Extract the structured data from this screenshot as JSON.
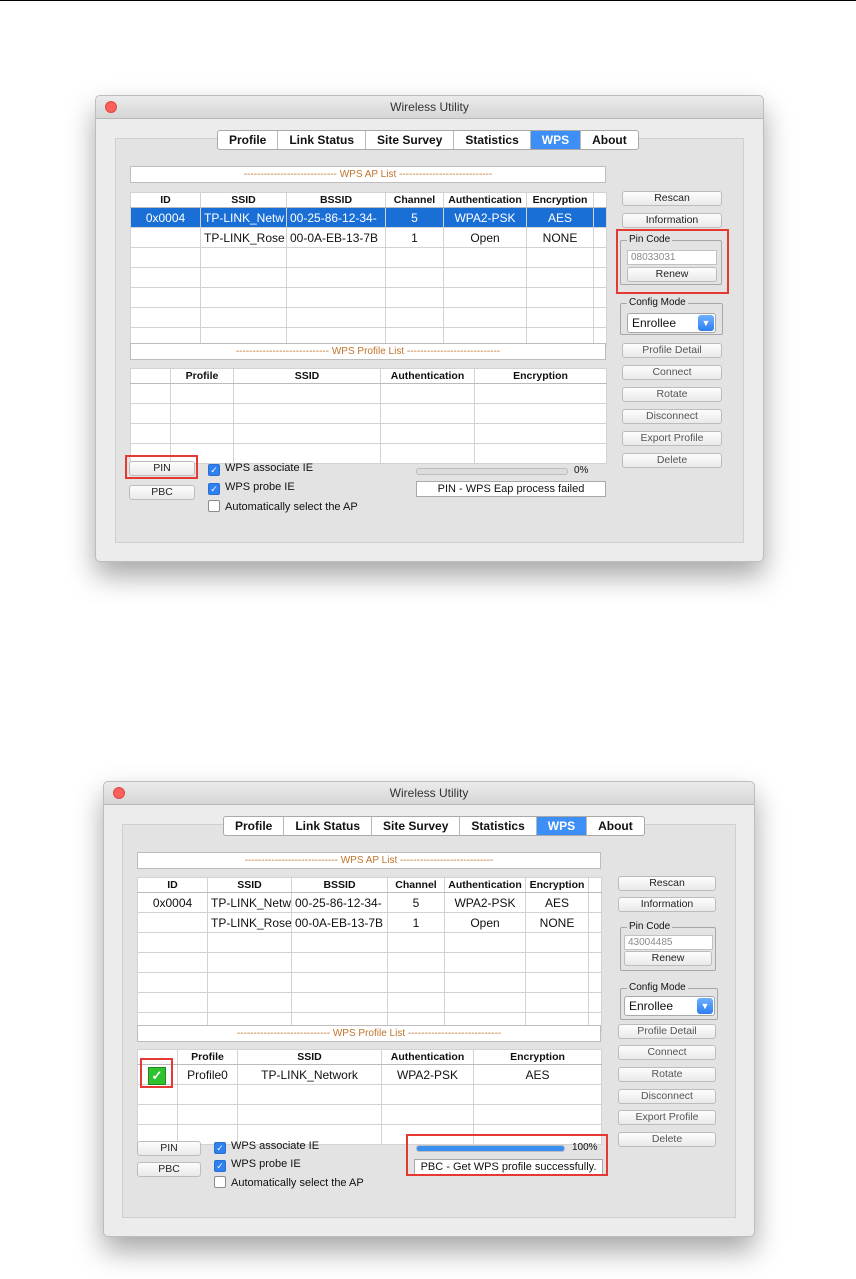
{
  "app_title": "Wireless Utility",
  "tabs": [
    "Profile",
    "Link Status",
    "Site Survey",
    "Statistics",
    "WPS",
    "About"
  ],
  "active_tab": "WPS",
  "ap_list_title": "---------------------------- WPS AP List ----------------------------",
  "profile_list_title": "---------------------------- WPS Profile List ----------------------------",
  "ap_columns": [
    "ID",
    "SSID",
    "BSSID",
    "Channel",
    "Authentication",
    "Encryption"
  ],
  "ap_rows": [
    {
      "id": "0x0004",
      "ssid": "TP-LINK_Netw",
      "bssid": "00-25-86-12-34-",
      "channel": "5",
      "auth": "WPA2-PSK",
      "enc": "AES"
    },
    {
      "id": "",
      "ssid": "TP-LINK_Rose",
      "bssid": "00-0A-EB-13-7B",
      "channel": "1",
      "auth": "Open",
      "enc": "NONE"
    }
  ],
  "profile_columns": [
    "",
    "Profile",
    "SSID",
    "Authentication",
    "Encryption"
  ],
  "side_buttons": {
    "rescan": "Rescan",
    "information": "Information",
    "pin_code_label": "Pin Code",
    "renew": "Renew",
    "config_mode_label": "Config Mode",
    "config_mode_value": "Enrollee",
    "profile_detail": "Profile Detail",
    "connect": "Connect",
    "rotate": "Rotate",
    "disconnect": "Disconnect",
    "export_profile": "Export Profile",
    "delete": "Delete"
  },
  "bottom": {
    "pin": "PIN",
    "pbc": "PBC",
    "wps_associate_ie": "WPS associate IE",
    "wps_probe_ie": "WPS probe IE",
    "auto_select": "Automatically select the AP"
  },
  "checkbox_states": {
    "wps_associate_ie": true,
    "wps_probe_ie": true,
    "auto_select": false
  },
  "check_glyph": "✓",
  "window1": {
    "pin_code": "08033031",
    "progress_label": "0%",
    "progress": 0,
    "status": "PIN - WPS Eap process failed",
    "profile_rows": []
  },
  "window2": {
    "pin_code": "43004485",
    "progress_label": "100%",
    "progress": 1,
    "status": "PBC - Get WPS profile successfully.",
    "profile_rows": [
      {
        "profile": "Profile0",
        "ssid": "TP-LINK_Network",
        "auth": "WPA2-PSK",
        "enc": "AES"
      }
    ]
  },
  "highlight_color": "#e53935"
}
